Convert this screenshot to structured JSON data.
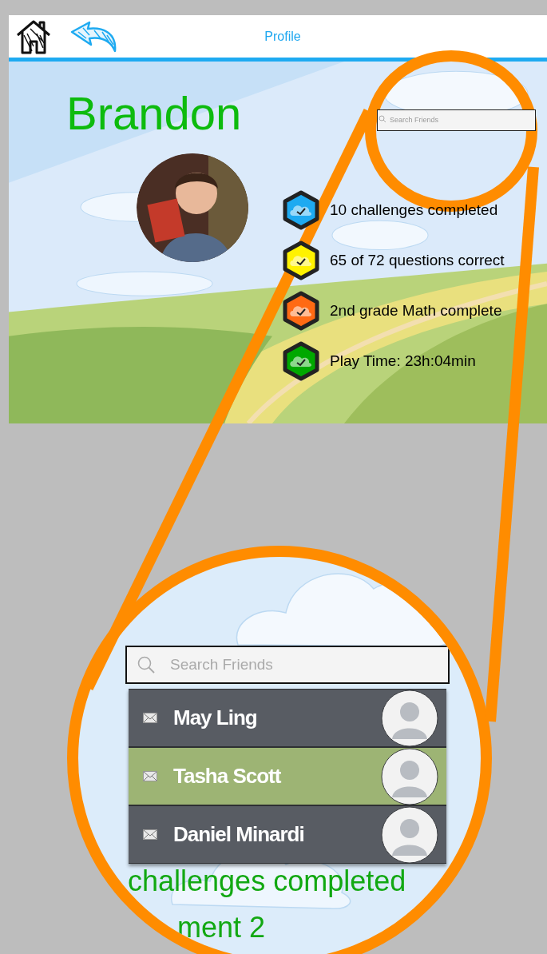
{
  "header": {
    "title": "Profile"
  },
  "profile": {
    "name": "Brandon"
  },
  "search": {
    "placeholder": "Search Friends"
  },
  "stats": [
    {
      "text": "10 challenges completed",
      "color": "#1eaaf1"
    },
    {
      "text": "65 of 72 questions correct",
      "color": "#fff200"
    },
    {
      "text": "2nd grade Math complete",
      "color": "#ff6a13"
    },
    {
      "text": "Play Time: 23h:04min",
      "color": "#00a800"
    }
  ],
  "magnifier": {
    "search": {
      "placeholder": "Search Friends"
    },
    "friends": [
      {
        "name": "May Ling",
        "selected": false
      },
      {
        "name": "Tasha Scott",
        "selected": true
      },
      {
        "name": "Daniel Minardi",
        "selected": false
      }
    ],
    "background_texts": [
      "challenges completed",
      "ment 2"
    ]
  }
}
